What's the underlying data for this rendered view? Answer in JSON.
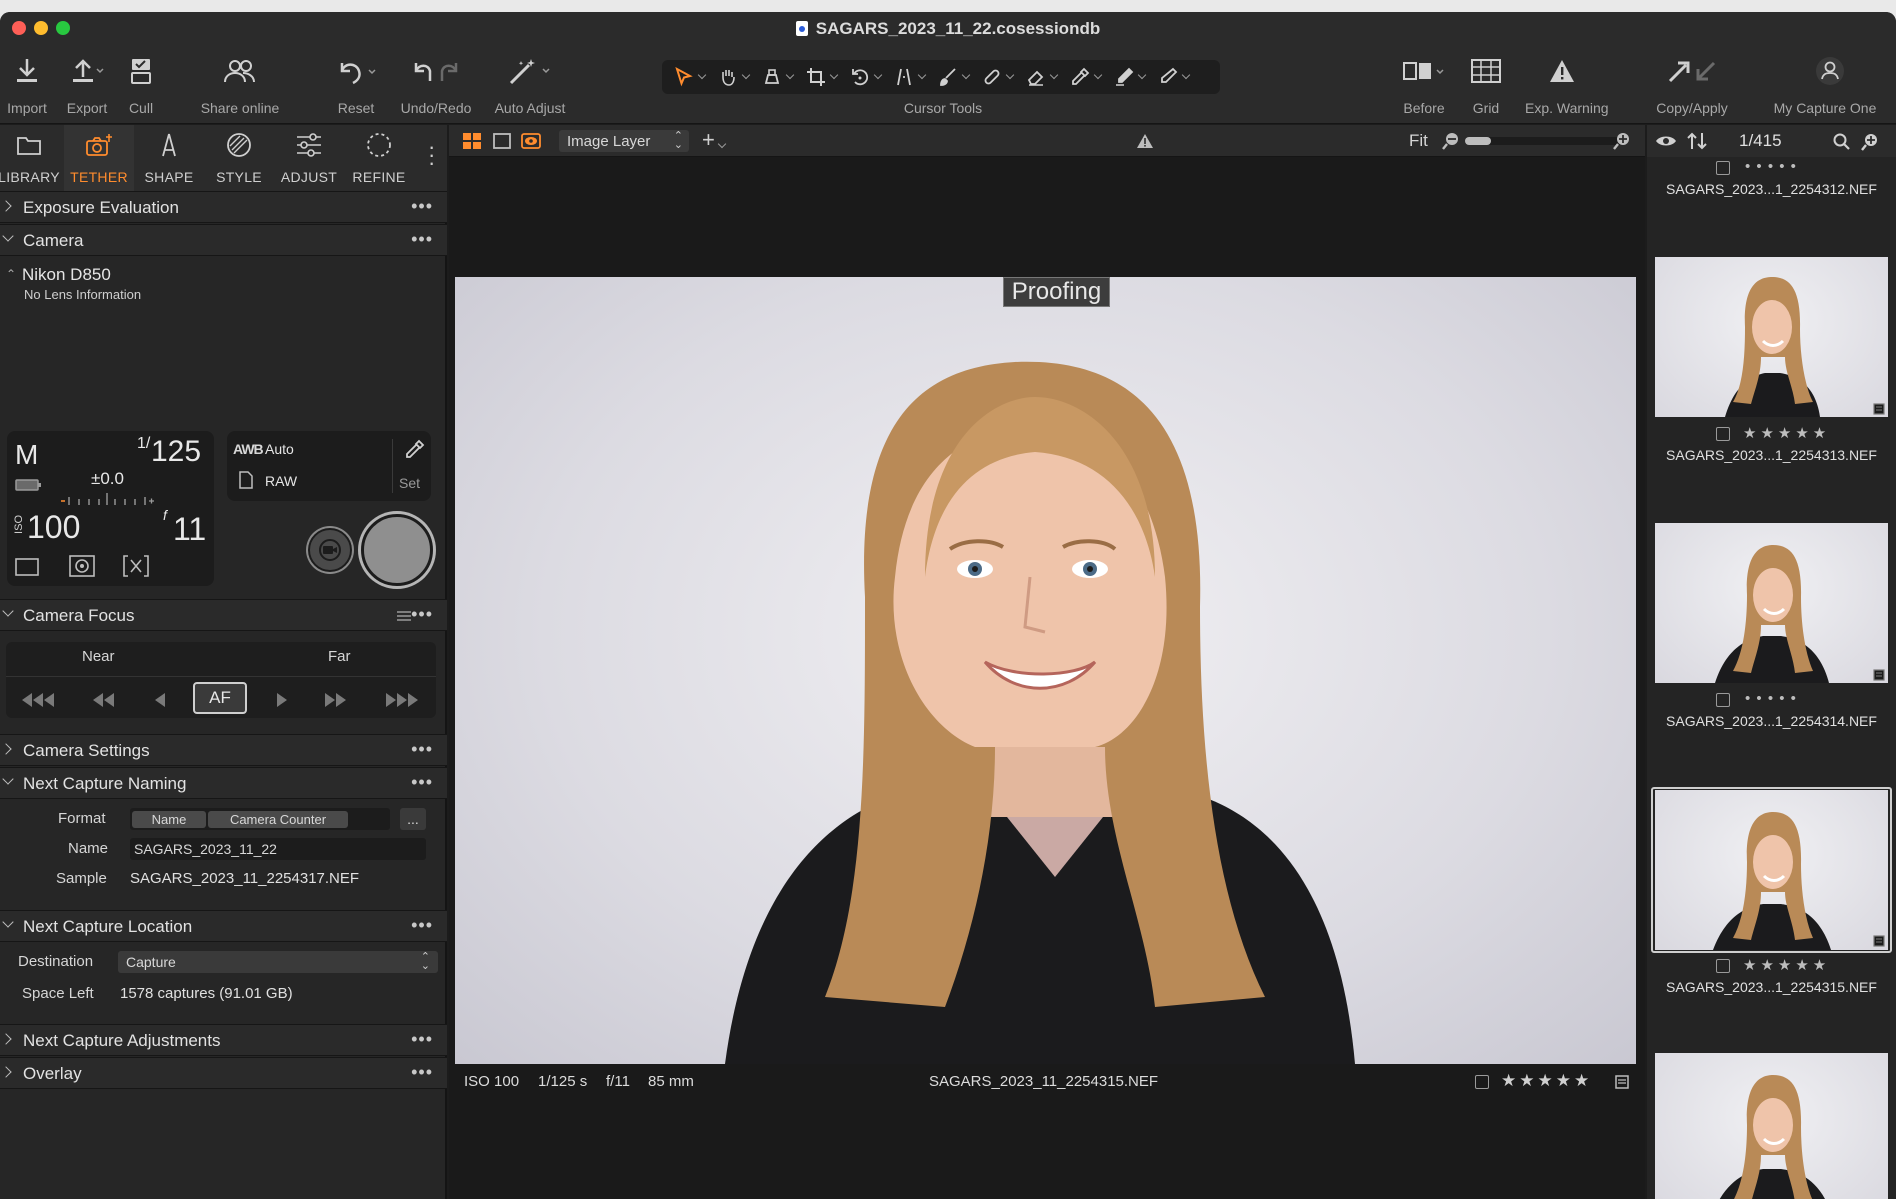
{
  "window": {
    "title": "SAGARS_2023_11_22.cosessiondb"
  },
  "toolbar": {
    "import": "Import",
    "export": "Export",
    "cull": "Cull",
    "share_online": "Share online",
    "reset": "Reset",
    "undo_redo": "Undo/Redo",
    "auto_adjust": "Auto Adjust",
    "cursor_tools": "Cursor Tools",
    "before": "Before",
    "grid": "Grid",
    "exp_warning": "Exp. Warning",
    "copy_apply": "Copy/Apply",
    "my_capture_one": "My Capture One"
  },
  "tabs": [
    "LIBRARY",
    "TETHER",
    "SHAPE",
    "STYLE",
    "ADJUST",
    "REFINE"
  ],
  "sections": {
    "exposure_evaluation": "Exposure Evaluation",
    "camera": "Camera",
    "camera_focus": "Camera Focus",
    "camera_settings": "Camera Settings",
    "next_capture_naming": "Next Capture Naming",
    "next_capture_location": "Next Capture Location",
    "next_capture_adjustments": "Next Capture Adjustments",
    "overlay": "Overlay"
  },
  "camera": {
    "model": "Nikon D850",
    "lens": "No Lens Information",
    "mode": "M",
    "shutter_num": "1/",
    "shutter_val": "125",
    "exposure_comp": "±0.0",
    "iso_label": "ISO",
    "iso": "100",
    "aperture_f": "f",
    "aperture": "11",
    "wb_label": "AWB",
    "wb_value": "Auto",
    "format": "RAW",
    "set": "Set"
  },
  "focus": {
    "near": "Near",
    "far": "Far",
    "af": "AF"
  },
  "naming": {
    "format_label": "Format",
    "tokens": [
      "Name",
      "Camera Counter"
    ],
    "more": "...",
    "name_label": "Name",
    "name_value": "SAGARS_2023_11_22",
    "sample_label": "Sample",
    "sample_value": "SAGARS_2023_11_2254317.NEF"
  },
  "location": {
    "destination_label": "Destination",
    "destination_value": "Capture",
    "space_label": "Space Left",
    "space_value": "1578 captures (91.01 GB)"
  },
  "viewer": {
    "layer": "Image Layer",
    "fit": "Fit",
    "proofing": "Proofing",
    "iso": "ISO 100",
    "shutter": "1/125 s",
    "aperture": "f/11",
    "focal": "85 mm",
    "filename": "SAGARS_2023_11_2254315.NEF",
    "stars": "★★★★★"
  },
  "browser": {
    "counter": "1/415",
    "items": [
      {
        "name": "SAGARS_2023...1_2254312.NEF",
        "rating": "• • • • •"
      },
      {
        "name": "SAGARS_2023...1_2254313.NEF",
        "rating": "★★★★★"
      },
      {
        "name": "SAGARS_2023...1_2254314.NEF",
        "rating": "• • • • •"
      },
      {
        "name": "SAGARS_2023...1_2254315.NEF",
        "rating": "★★★★★"
      }
    ]
  },
  "colors": {
    "accent": "#ff8c2e",
    "panel": "#262626",
    "viewer": "#1a1a1a"
  }
}
